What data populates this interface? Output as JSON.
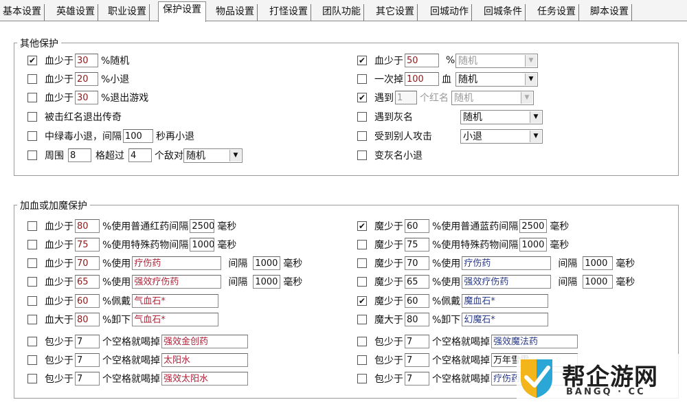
{
  "tabs": [
    "基本设置",
    "英雄设置",
    "职业设置",
    "保护设置",
    "物品设置",
    "打怪设置",
    "团队功能",
    "其它设置",
    "回城动作",
    "回城条件",
    "任务设置",
    "脚本设置"
  ],
  "other_protect": {
    "title": "其他保护",
    "left": {
      "r1": {
        "checked": "✔",
        "label": "血少于",
        "value": "30",
        "suffix": "%随机"
      },
      "r2": {
        "label": "血少于",
        "value": "20",
        "suffix": "%小退"
      },
      "r3": {
        "label": "血少于",
        "value": "30",
        "suffix": "%退出游戏"
      },
      "r4": {
        "label": "被击红名退出传奇"
      },
      "r5": {
        "label": "中绿毒小退，间隔",
        "value": "100",
        "suffix": "秒再小退"
      },
      "r6": {
        "label": "周围",
        "value": "8",
        "mid": "格超过",
        "value2": "4",
        "mid2": "个敌对",
        "combo": "随机"
      }
    },
    "right": {
      "r1": {
        "checked": "✔",
        "label": "血少于",
        "value": "50",
        "suffix": "%",
        "combo": "随机"
      },
      "r2": {
        "label": "一次掉",
        "value": "100",
        "suffix": "血",
        "combo": "随机"
      },
      "r3": {
        "checked": "✔",
        "label": "遇到",
        "value": "1",
        "suffix": "个红名",
        "combo": "随机"
      },
      "r4": {
        "label": "遇到灰名",
        "combo": "随机"
      },
      "r5": {
        "label": "受到别人攻击",
        "combo": "小退"
      },
      "r6": {
        "label": "变灰名小退"
      }
    }
  },
  "heal_protect": {
    "title": "加血或加魔保护",
    "left": {
      "r1": {
        "label": "血少于",
        "value": "80",
        "mid": "%使用普通红药间隔",
        "value2": "2500",
        "suffix": "毫秒"
      },
      "r2": {
        "label": "血少于",
        "value": "75",
        "mid": "%使用特殊药物间隔",
        "value2": "1000",
        "suffix": "毫秒"
      },
      "r3": {
        "label": "血少于",
        "value": "70",
        "mid": "%使用",
        "item": "疗伤药",
        "mid2": "间隔",
        "value2": "1000",
        "suffix": "毫秒"
      },
      "r4": {
        "label": "血少于",
        "value": "65",
        "mid": "%使用",
        "item": "强效疗伤药",
        "mid2": "间隔",
        "value2": "1000",
        "suffix": "毫秒"
      },
      "r5": {
        "label": "血少于",
        "value": "60",
        "mid": "%佩戴",
        "item": "气血石*"
      },
      "r6": {
        "label": "血大于",
        "value": "80",
        "mid": "%卸下",
        "item": "气血石*"
      },
      "r7": {
        "label": "包少于",
        "value": "7",
        "mid": "个空格就喝掉",
        "item": "强效金创药"
      },
      "r8": {
        "label": "包少于",
        "value": "7",
        "mid": "个空格就喝掉",
        "item": "太阳水"
      },
      "r9": {
        "label": "包少于",
        "value": "7",
        "mid": "个空格就喝掉",
        "item": "强效太阳水"
      }
    },
    "right": {
      "r1": {
        "checked": "✔",
        "label": "魔少于",
        "value": "60",
        "mid": "%使用普通蓝药间隔",
        "value2": "2500",
        "suffix": "毫秒"
      },
      "r2": {
        "label": "魔少于",
        "value": "75",
        "mid": "%使用特殊药物间隔",
        "value2": "1000",
        "suffix": "毫秒"
      },
      "r3": {
        "label": "魔少于",
        "value": "70",
        "mid": "%使用",
        "item": "疗伤药",
        "mid2": "间隔",
        "value2": "1000",
        "suffix": "毫秒"
      },
      "r4": {
        "label": "魔少于",
        "value": "65",
        "mid": "%使用",
        "item": "强效疗伤药",
        "mid2": "间隔",
        "value2": "1000",
        "suffix": "毫秒"
      },
      "r5": {
        "checked": "✔",
        "label": "魔少于",
        "value": "60",
        "mid": "%佩戴",
        "item": "魔血石*"
      },
      "r6": {
        "label": "魔大于",
        "value": "80",
        "mid": "%卸下",
        "item": "幻魔石*"
      },
      "r7": {
        "label": "包少于",
        "value": "7",
        "mid": "个空格就喝掉",
        "item": "强效魔法药"
      },
      "r8": {
        "label": "包少于",
        "value": "7",
        "mid": "个空格就喝掉",
        "item": "万年雪霜"
      },
      "r9": {
        "label": "包少于",
        "value": "7",
        "mid": "个空格就喝掉",
        "item": "疗伤药"
      }
    }
  },
  "watermark": {
    "brand": "帮企游网",
    "domain": "BANGQ · CC"
  }
}
